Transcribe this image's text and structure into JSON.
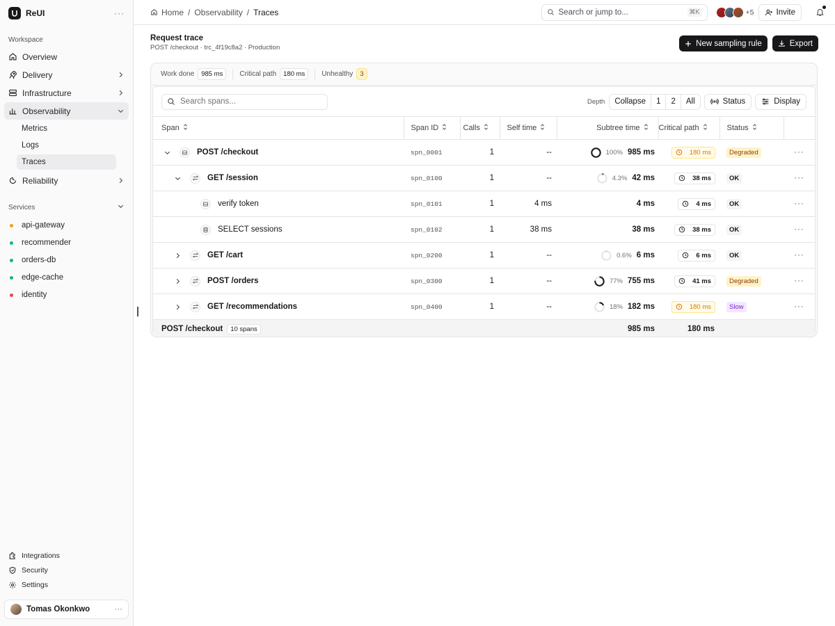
{
  "app": {
    "name": "ReUI"
  },
  "sidebar": {
    "workspace_label": "Workspace",
    "items": [
      {
        "label": "Overview",
        "icon": "home-icon"
      },
      {
        "label": "Delivery",
        "icon": "rocket-icon"
      },
      {
        "label": "Infrastructure",
        "icon": "server-icon"
      },
      {
        "label": "Observability",
        "icon": "bar-chart-icon"
      },
      {
        "label": "Reliability",
        "icon": "bug-icon"
      }
    ],
    "sub_items": [
      "Metrics",
      "Logs",
      "Traces"
    ],
    "services_label": "Services",
    "services": [
      {
        "name": "api-gateway",
        "color": "#f59e0b"
      },
      {
        "name": "recommender",
        "color": "#10b981"
      },
      {
        "name": "orders-db",
        "color": "#10b981"
      },
      {
        "name": "edge-cache",
        "color": "#10b981"
      },
      {
        "name": "identity",
        "color": "#ef4444"
      }
    ],
    "bottom": [
      {
        "label": "Integrations",
        "icon": "puzzle-icon"
      },
      {
        "label": "Security",
        "icon": "shield-icon"
      },
      {
        "label": "Settings",
        "icon": "gear-icon"
      }
    ],
    "user": "Tomas Okonkwo"
  },
  "topbar": {
    "breadcrumbs": [
      "Home",
      "Observability",
      "Traces"
    ],
    "search_placeholder": "Search or jump to...",
    "shortcut": "⌘K",
    "extra_count": "+5",
    "invite_label": "Invite"
  },
  "page": {
    "title": "Request trace",
    "subtitle": "POST /checkout · trc_4f19c8a2 · Production",
    "new_rule_label": "New sampling rule",
    "export_label": "Export"
  },
  "stats": {
    "work_done_label": "Work done",
    "work_done": "985 ms",
    "critical_label": "Critical path",
    "critical": "180 ms",
    "unhealthy_label": "Unhealthy",
    "unhealthy": "3"
  },
  "toolbar": {
    "search_placeholder": "Search spans...",
    "depth_label": "Depth",
    "depth_options": [
      "Collapse",
      "1",
      "2",
      "All"
    ],
    "status_label": "Status",
    "display_label": "Display"
  },
  "table": {
    "columns": [
      "Span",
      "Span ID",
      "Calls",
      "Self time",
      "Subtree time",
      "Critical path",
      "Status"
    ],
    "rows": [
      {
        "name": "POST /checkout",
        "id": "spn_0001",
        "calls": "1",
        "self": "--",
        "pct": "100%",
        "pct_value": 100,
        "subtree": "985 ms",
        "critical": "180 ms",
        "critical_warn": true,
        "status": "Degraded",
        "status_kind": "deg",
        "level": 0,
        "expand": "down",
        "icon": "server-icon"
      },
      {
        "name": "GET /session",
        "id": "spn_0100",
        "calls": "1",
        "self": "--",
        "pct": "4.3%",
        "pct_value": 4.3,
        "subtree": "42 ms",
        "critical": "38 ms",
        "critical_warn": false,
        "status": "OK",
        "status_kind": "ok",
        "level": 1,
        "expand": "down",
        "icon": "arrows-icon"
      },
      {
        "name": "verify token",
        "id": "spn_0101",
        "calls": "1",
        "self": "4 ms",
        "pct": "",
        "pct_value": null,
        "subtree": "4 ms",
        "critical": "4 ms",
        "critical_warn": false,
        "status": "OK",
        "status_kind": "ok",
        "level": 2,
        "expand": "",
        "icon": "server-icon"
      },
      {
        "name": "SELECT sessions",
        "id": "spn_0102",
        "calls": "1",
        "self": "38 ms",
        "pct": "",
        "pct_value": null,
        "subtree": "38 ms",
        "critical": "38 ms",
        "critical_warn": false,
        "status": "OK",
        "status_kind": "ok",
        "level": 2,
        "expand": "",
        "icon": "database-icon"
      },
      {
        "name": "GET /cart",
        "id": "spn_0200",
        "calls": "1",
        "self": "--",
        "pct": "0.6%",
        "pct_value": 0.6,
        "subtree": "6 ms",
        "critical": "6 ms",
        "critical_warn": false,
        "status": "OK",
        "status_kind": "ok",
        "level": 1,
        "expand": "right",
        "icon": "arrows-icon"
      },
      {
        "name": "POST /orders",
        "id": "spn_0300",
        "calls": "1",
        "self": "--",
        "pct": "77%",
        "pct_value": 77,
        "subtree": "755 ms",
        "critical": "41 ms",
        "critical_warn": false,
        "status": "Degraded",
        "status_kind": "deg",
        "level": 1,
        "expand": "right",
        "icon": "arrows-icon"
      },
      {
        "name": "GET /recommendations",
        "id": "spn_0400",
        "calls": "1",
        "self": "--",
        "pct": "18%",
        "pct_value": 18,
        "subtree": "182 ms",
        "critical": "180 ms",
        "critical_warn": true,
        "status": "Slow",
        "status_kind": "slow",
        "level": 1,
        "expand": "right",
        "icon": "arrows-icon"
      }
    ],
    "footer": {
      "name": "POST /checkout",
      "count": "10 spans",
      "subtree": "985 ms",
      "critical": "180 ms"
    }
  }
}
